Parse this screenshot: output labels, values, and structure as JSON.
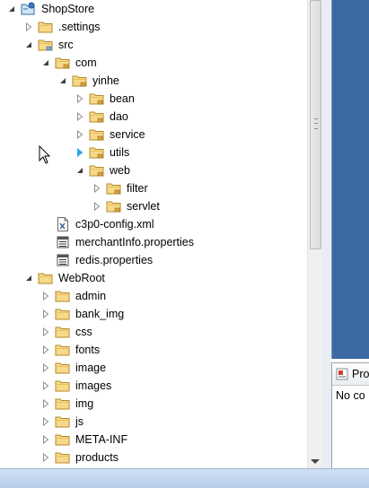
{
  "tree": [
    {
      "label": "ShopStore",
      "depth": 0,
      "state": "expanded",
      "icon": "project-icon"
    },
    {
      "label": ".settings",
      "depth": 1,
      "state": "collapsed",
      "icon": "folder-icon"
    },
    {
      "label": "src",
      "depth": 1,
      "state": "expanded",
      "icon": "source-folder-icon"
    },
    {
      "label": "com",
      "depth": 2,
      "state": "expanded",
      "icon": "package-folder-icon"
    },
    {
      "label": "yinhe",
      "depth": 3,
      "state": "expanded",
      "icon": "package-folder-icon"
    },
    {
      "label": "bean",
      "depth": 4,
      "state": "collapsed",
      "icon": "package-folder-icon"
    },
    {
      "label": "dao",
      "depth": 4,
      "state": "collapsed",
      "icon": "package-folder-icon"
    },
    {
      "label": "service",
      "depth": 4,
      "state": "collapsed",
      "icon": "package-folder-icon"
    },
    {
      "label": "utils",
      "depth": 4,
      "state": "collapsed-hover",
      "icon": "package-folder-icon"
    },
    {
      "label": "web",
      "depth": 4,
      "state": "expanded",
      "icon": "package-folder-icon"
    },
    {
      "label": "filter",
      "depth": 5,
      "state": "collapsed",
      "icon": "package-folder-icon"
    },
    {
      "label": "servlet",
      "depth": 5,
      "state": "collapsed",
      "icon": "package-folder-icon"
    },
    {
      "label": "c3p0-config.xml",
      "depth": 2,
      "state": "leaf",
      "icon": "xml-file-icon"
    },
    {
      "label": "merchantInfo.properties",
      "depth": 2,
      "state": "leaf",
      "icon": "properties-file-icon"
    },
    {
      "label": "redis.properties",
      "depth": 2,
      "state": "leaf",
      "icon": "properties-file-icon"
    },
    {
      "label": "WebRoot",
      "depth": 1,
      "state": "expanded",
      "icon": "folder-icon"
    },
    {
      "label": "admin",
      "depth": 2,
      "state": "collapsed",
      "icon": "folder-icon"
    },
    {
      "label": "bank_img",
      "depth": 2,
      "state": "collapsed",
      "icon": "folder-icon"
    },
    {
      "label": "css",
      "depth": 2,
      "state": "collapsed",
      "icon": "folder-icon"
    },
    {
      "label": "fonts",
      "depth": 2,
      "state": "collapsed",
      "icon": "folder-icon"
    },
    {
      "label": "image",
      "depth": 2,
      "state": "collapsed",
      "icon": "folder-icon"
    },
    {
      "label": "images",
      "depth": 2,
      "state": "collapsed",
      "icon": "folder-icon"
    },
    {
      "label": "img",
      "depth": 2,
      "state": "collapsed",
      "icon": "folder-icon"
    },
    {
      "label": "js",
      "depth": 2,
      "state": "collapsed",
      "icon": "folder-icon"
    },
    {
      "label": "META-INF",
      "depth": 2,
      "state": "collapsed",
      "icon": "folder-icon"
    },
    {
      "label": "products",
      "depth": 2,
      "state": "collapsed",
      "icon": "folder-icon"
    }
  ],
  "properties_panel": {
    "tab_label": "Pro",
    "message": "No co"
  },
  "colors": {
    "editor_background": "#3b69a3",
    "folder_fill": "#f6d98a",
    "hover_arrow": "#29a8e0"
  }
}
